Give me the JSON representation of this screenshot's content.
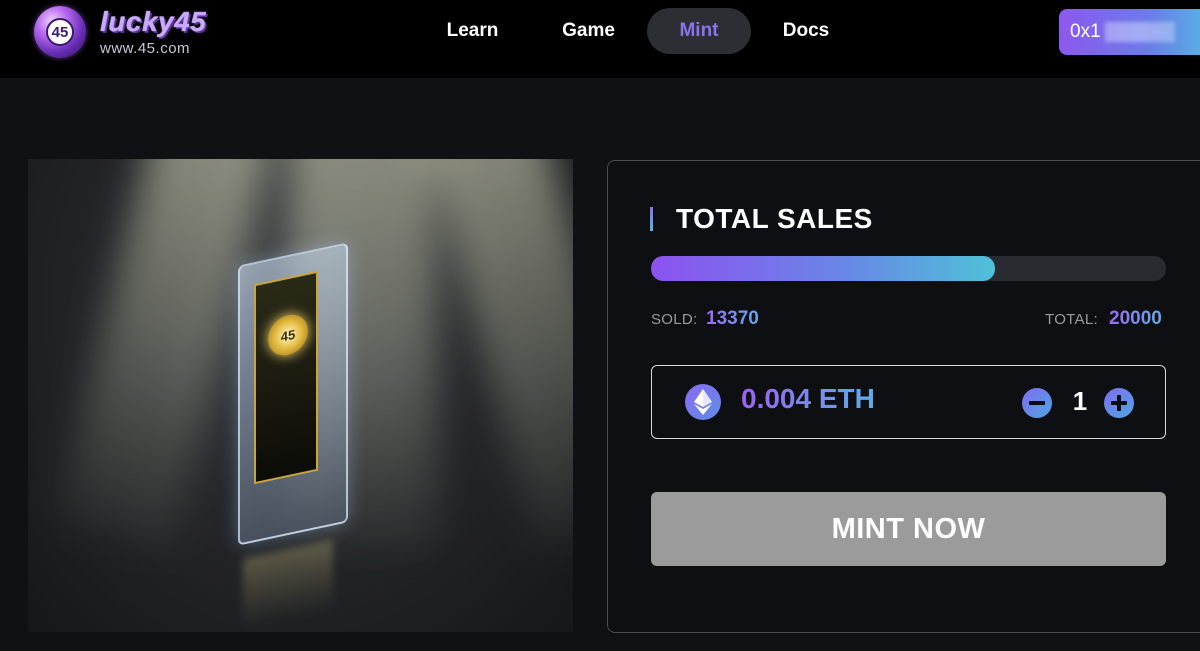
{
  "header": {
    "logo": {
      "number": "45",
      "word": "lucky45",
      "url": "www.45.com"
    },
    "nav": [
      {
        "label": "Learn",
        "active": false
      },
      {
        "label": "Game",
        "active": false
      },
      {
        "label": "Mint",
        "active": true
      },
      {
        "label": "Docs",
        "active": false
      }
    ],
    "wallet": {
      "address_prefix": "0x1"
    }
  },
  "hero": {
    "card_number": "45",
    "description": "NFT card render"
  },
  "sales": {
    "title": "TOTAL SALES",
    "sold_label": "SOLD:",
    "sold_value": "13370",
    "total_label": "TOTAL:",
    "total_value": "20000",
    "progress_fraction": 0.6685
  },
  "mint": {
    "price": "0.004 ETH",
    "currency_icon": "ethereum-icon",
    "quantity": "1",
    "button_label": "MINT NOW"
  },
  "colors": {
    "accent_purple": "#8c52f0",
    "accent_cyan": "#4ec1d8",
    "background": "#101114",
    "disabled_button": "#9b9b9b"
  }
}
